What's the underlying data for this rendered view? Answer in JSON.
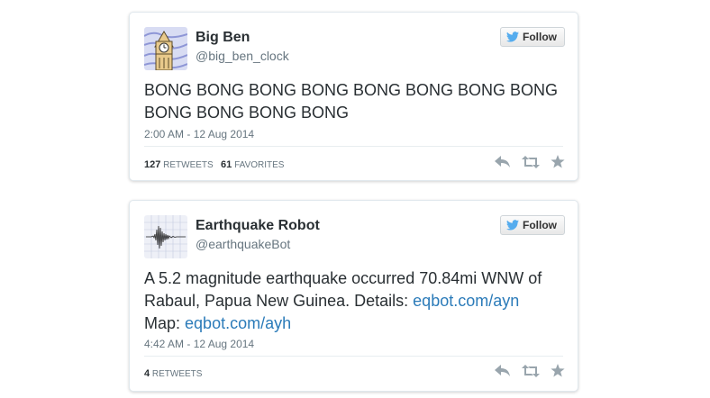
{
  "tweets": [
    {
      "name": "Big Ben",
      "handle": "@big_ben_clock",
      "follow_label": "Follow",
      "text": "BONG BONG BONG BONG BONG BONG BONG BONG BONG BONG BONG BONG",
      "timestamp": "2:00 AM - 12 Aug 2014",
      "retweets_count": "127",
      "retweets_label": "RETWEETS",
      "favorites_count": "61",
      "favorites_label": "FAVORITES"
    },
    {
      "name": "Earthquake Robot",
      "handle": "@earthquakeBot",
      "follow_label": "Follow",
      "text_prefix": "A 5.2 magnitude earthquake occurred 70.84mi WNW of Rabaul, Papua New Guinea. Details: ",
      "link_details": "eqbot.com/ayn",
      "text_map": "Map: ",
      "link_map": "eqbot.com/ayh",
      "timestamp": "4:42 AM - 12 Aug 2014",
      "retweets_count": "4",
      "retweets_label": "RETWEETS"
    }
  ],
  "colors": {
    "link": "#2b7bb9",
    "twitter_blue": "#55acee",
    "text": "#292f33",
    "muted": "#66757f"
  },
  "icons": [
    "twitter-bird-icon",
    "reply-icon",
    "retweet-icon",
    "favorite-star-icon"
  ]
}
